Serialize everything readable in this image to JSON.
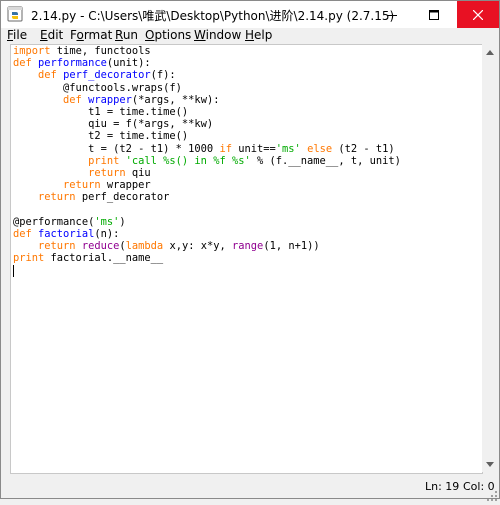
{
  "window": {
    "title": "2.14.py - C:\\Users\\唯武\\Desktop\\Python\\进阶\\2.14.py (2.7.15)"
  },
  "menu": {
    "file": {
      "mnemonic": "F",
      "rest": "ile"
    },
    "edit": {
      "mnemonic": "E",
      "rest": "dit"
    },
    "format": {
      "pre": "F",
      "mnemonic": "o",
      "rest": "rmat"
    },
    "run": {
      "mnemonic": "R",
      "rest": "un"
    },
    "options": {
      "mnemonic": "O",
      "rest": "ptions"
    },
    "window": {
      "mnemonic": "W",
      "rest": "indow"
    },
    "help": {
      "mnemonic": "H",
      "rest": "elp"
    }
  },
  "code": {
    "line1": {
      "kw": "import",
      "text": " time, functools"
    },
    "line2": {
      "kw": "def",
      "name": " performance",
      "text": "(unit):"
    },
    "line3": {
      "indent": "    ",
      "kw": "def",
      "name": " perf_decorator",
      "text": "(f):"
    },
    "line4": {
      "text": "        @functools.wraps(f)"
    },
    "line5": {
      "indent": "        ",
      "kw": "def",
      "name": " wrapper",
      "text": "(*args, **kw):"
    },
    "line6": {
      "text": "            t1 = time.time()"
    },
    "line7": {
      "text": "            qiu = f(*args, **kw)"
    },
    "line8": {
      "text": "            t2 = time.time()"
    },
    "line9": {
      "p1": "            t = (t2 - t1) * 1000 ",
      "kw1": "if",
      "p2": " unit==",
      "str": "'ms'",
      "p3": " ",
      "kw2": "else",
      "p4": " (t2 - t1)"
    },
    "line10": {
      "indent": "            ",
      "kw": "print",
      "str": " 'call %s() in %f %s'",
      "text": " % (f.__name__, t, unit)"
    },
    "line11": {
      "indent": "            ",
      "kw": "return",
      "text": " qiu"
    },
    "line12": {
      "indent": "        ",
      "kw": "return",
      "text": " wrapper"
    },
    "line13": {
      "indent": "    ",
      "kw": "return",
      "text": " perf_decorator"
    },
    "line15": {
      "p1": "@performance(",
      "str": "'ms'",
      "p2": ")"
    },
    "line16": {
      "kw": "def",
      "name": " factorial",
      "text": "(n):"
    },
    "line17": {
      "indent": "    ",
      "kw": "return",
      "sp": " ",
      "bi1": "reduce",
      "p1": "(",
      "kw2": "lambda",
      "p2": " x,y: x*y, ",
      "bi2": "range",
      "p3": "(1, n+1))"
    },
    "line18": {
      "kw": "print",
      "text": " factorial.__name__"
    }
  },
  "status": {
    "line": "Ln: 19",
    "col": "Col: 0"
  },
  "icons": {
    "app": "python-idle-icon",
    "minimize": "minimize-icon",
    "maximize": "maximize-icon",
    "close": "close-icon",
    "scroll_up": "scroll-up-arrow-icon",
    "scroll_down": "scroll-down-arrow-icon",
    "grip": "resize-grip-icon"
  },
  "colors": {
    "keyword": "#ff7700",
    "definition": "#0000ff",
    "string": "#00aa00",
    "builtin": "#900090",
    "close_button": "#e81123"
  }
}
